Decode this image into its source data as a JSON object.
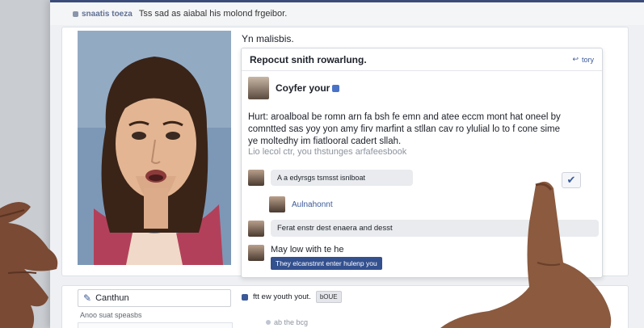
{
  "topbar": {
    "app_name": "snaatis toeza",
    "message": "Tss sad as aiabal his molond frgeibor."
  },
  "heading": "Yn malisbis.",
  "panel": {
    "title": "Repocut snith rowarlung.",
    "link_label": "tory"
  },
  "post": {
    "author": "Coyfer your",
    "body": "Hurt: aroalboal be romn arn fa bsh fe emn and atee eccm mont hat oneel by comntted sas yoy yon amy firv marfint a stllan cav ro ylulial lo to f cone sime ye moltedhy im fiatlooral cadert sllah.",
    "meta": "Lio lecol ctr, you thstunges arfafeesbook"
  },
  "comments": [
    {
      "text": "A a edyrsgs tsmsst isnlboat"
    },
    {
      "name": "Aulnahonnt"
    },
    {
      "text": "Ferat enstr dest enaera and desst"
    },
    {
      "text": "May low with te he",
      "button": "They elcanstnnt enter hulenp you"
    }
  ],
  "compose": {
    "label": "Canthun",
    "subtitle": "Anoo suat speasbs",
    "share_text": "ftt ew youth yout.",
    "share_button": "bOUE",
    "footer_text": "ab the bcg"
  },
  "colors": {
    "accent": "#3b5998",
    "topbar_rule": "#3b4c7a",
    "button": "#33508f"
  }
}
